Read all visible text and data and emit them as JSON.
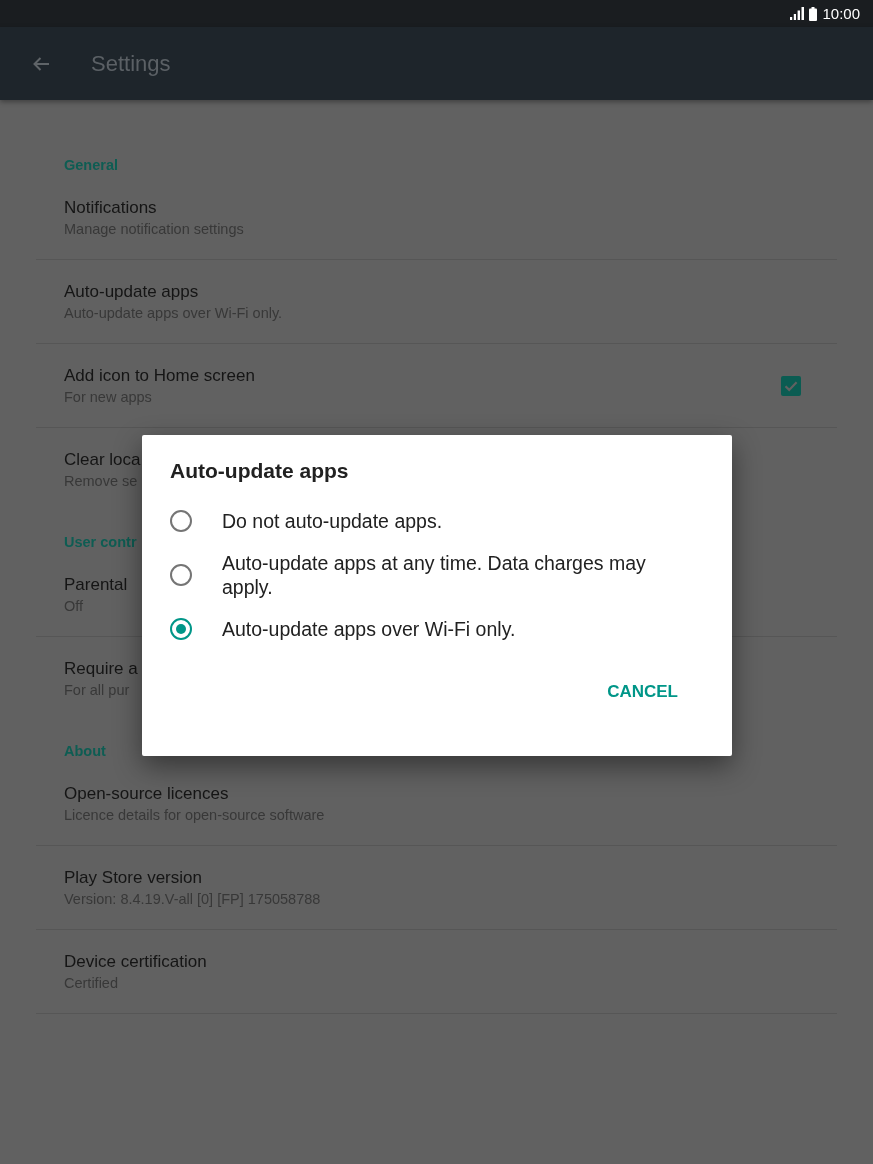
{
  "status_bar": {
    "time": "10:00"
  },
  "app_bar": {
    "title": "Settings"
  },
  "sections": [
    {
      "header": "General",
      "items": [
        {
          "kind": "plain",
          "title": "Notifications",
          "subtitle": "Manage notification settings"
        },
        {
          "kind": "plain",
          "title": "Auto-update apps",
          "subtitle": "Auto-update apps over Wi-Fi only."
        },
        {
          "kind": "checkbox",
          "title": "Add icon to Home screen",
          "subtitle": "For new apps",
          "checked": true
        },
        {
          "kind": "plain",
          "title": "Clear loca",
          "subtitle": "Remove se"
        }
      ]
    },
    {
      "header": "User contr",
      "items": [
        {
          "kind": "plain",
          "title": "Parental",
          "subtitle": "Off"
        },
        {
          "kind": "plain",
          "title": "Require a",
          "subtitle": "For all pur"
        }
      ]
    },
    {
      "header": "About",
      "items": [
        {
          "kind": "plain",
          "title": "Open-source licences",
          "subtitle": "Licence details for open-source software"
        },
        {
          "kind": "plain",
          "title": "Play Store version",
          "subtitle": "Version: 8.4.19.V-all [0] [FP] 175058788"
        },
        {
          "kind": "plain",
          "title": "Device certification",
          "subtitle": "Certified"
        }
      ]
    }
  ],
  "dialog": {
    "title": "Auto-update apps",
    "options": [
      {
        "label": "Do not auto-update apps.",
        "selected": false
      },
      {
        "label": "Auto-update apps at any time. Data charges may apply.",
        "selected": false
      },
      {
        "label": "Auto-update apps over Wi-Fi only.",
        "selected": true
      }
    ],
    "buttons": [
      "CANCEL"
    ]
  }
}
